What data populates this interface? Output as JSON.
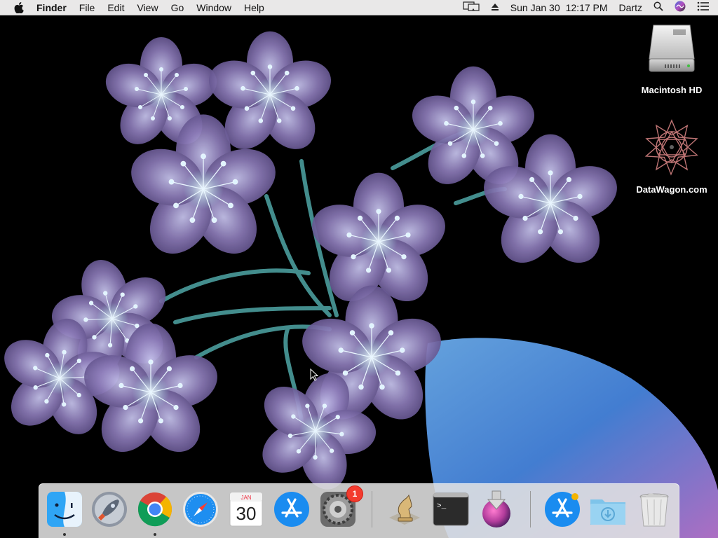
{
  "menubar": {
    "app_name": "Finder",
    "menus": [
      "File",
      "Edit",
      "View",
      "Go",
      "Window",
      "Help"
    ],
    "date": "Sun Jan 30",
    "time": "12:17 PM",
    "user": "Dartz",
    "status_icons": [
      "display-mirroring-icon",
      "eject-icon",
      "spotlight-search-icon",
      "siri-icon",
      "notification-center-icon"
    ]
  },
  "desktop": {
    "icons": [
      {
        "name": "macintosh-hd",
        "label": "Macintosh HD",
        "icon": "hard-drive-icon"
      },
      {
        "name": "datawagon",
        "label": "DataWagon.com",
        "icon": "star-mandala-icon"
      }
    ]
  },
  "dock": {
    "apps": [
      {
        "name": "Finder",
        "icon": "finder-icon",
        "running": true
      },
      {
        "name": "Launchpad",
        "icon": "launchpad-rocket-icon",
        "running": false
      },
      {
        "name": "Google Chrome",
        "icon": "chrome-icon",
        "running": true
      },
      {
        "name": "Safari",
        "icon": "safari-compass-icon",
        "running": false
      },
      {
        "name": "Calendar",
        "icon": "calendar-icon",
        "running": false,
        "month": "JAN",
        "day": "30"
      },
      {
        "name": "App Store",
        "icon": "app-store-icon",
        "running": false
      },
      {
        "name": "System Preferences",
        "icon": "gear-icon",
        "running": false,
        "badge": "1"
      },
      {
        "name": "Chess",
        "icon": "chess-knight-icon",
        "running": false
      },
      {
        "name": "Terminal",
        "icon": "terminal-icon",
        "running": false,
        "prompt": ">_"
      },
      {
        "name": "macOS Installer",
        "icon": "installer-download-icon",
        "running": false
      },
      {
        "name": "Applications",
        "icon": "app-store-folder-icon",
        "running": false
      },
      {
        "name": "Downloads",
        "icon": "downloads-folder-icon",
        "running": false
      },
      {
        "name": "Trash",
        "icon": "trash-icon",
        "running": false
      }
    ]
  },
  "colors": {
    "menubar_bg": "#e9e8e8",
    "dock_bg": "#e1e1e1",
    "badge": "#f33b2e",
    "wallpaper_bg": "#000000"
  }
}
